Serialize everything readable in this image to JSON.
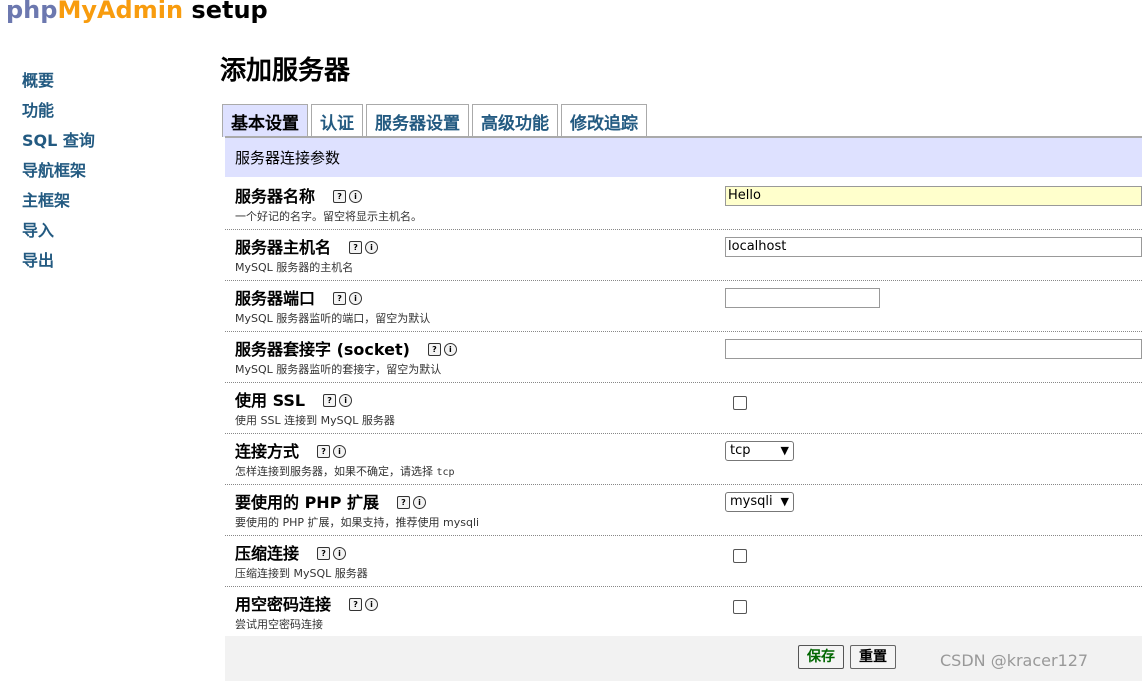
{
  "app": {
    "logo_part1": "php",
    "logo_part2": "MyAdmin",
    "logo_part3": " setup"
  },
  "sidebar": {
    "items": [
      "概要",
      "功能",
      "SQL 查询",
      "导航框架",
      "主框架",
      "导入",
      "导出"
    ]
  },
  "page": {
    "title": "添加服务器"
  },
  "tabs": [
    "基本设置",
    "认证",
    "服务器设置",
    "高级功能",
    "修改追踪"
  ],
  "panel": {
    "legend": "服务器连接参数",
    "rows": [
      {
        "label": "服务器名称",
        "desc": "一个好记的名字。留空将显示主机名。",
        "value": "Hello"
      },
      {
        "label": "服务器主机名",
        "desc": "MySQL 服务器的主机名",
        "value": "localhost"
      },
      {
        "label": "服务器端口",
        "desc": "MySQL 服务器监听的端口，留空为默认",
        "value": ""
      },
      {
        "label": "服务器套接字 (socket)",
        "desc": "MySQL 服务器监听的套接字，留空为默认",
        "value": ""
      },
      {
        "label": "使用 SSL",
        "desc": "使用 SSL 连接到 MySQL 服务器"
      },
      {
        "label": "连接方式",
        "desc": "怎样连接到服务器，如果不确定，请选择 ",
        "desc_mono": "tcp",
        "value": "tcp"
      },
      {
        "label": "要使用的 PHP 扩展",
        "desc": "要使用的 PHP 扩展，如果支持，推荐使用 mysqli",
        "value": "mysqli"
      },
      {
        "label": "压缩连接",
        "desc": "压缩连接到 MySQL 服务器"
      },
      {
        "label": "用空密码连接",
        "desc": "尝试用空密码连接"
      }
    ],
    "help_icon": "?",
    "info_icon": "i"
  },
  "buttons": {
    "save": "保存",
    "reset": "重置"
  },
  "watermark": "CSDN @kracer127",
  "colors": {
    "link": "#235a81",
    "tab_active_bg": "#dee1ff",
    "logo_blue": "#6c78af",
    "logo_orange": "#f89c0e",
    "highlight_input": "#ffffcc"
  }
}
